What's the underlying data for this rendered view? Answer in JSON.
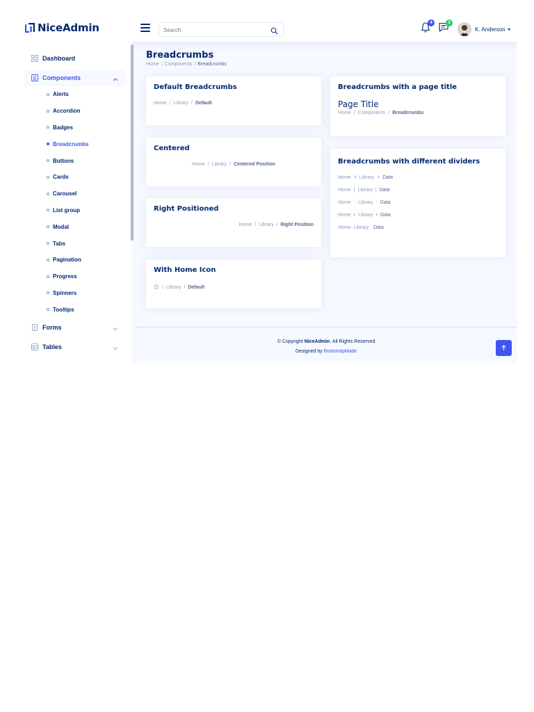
{
  "app": {
    "brand": "NiceAdmin"
  },
  "header": {
    "search_placeholder": "Search",
    "notifications_count": "4",
    "messages_count": "3",
    "profile_name": "K. Anderson"
  },
  "colors": {
    "accent": "#4154f1",
    "navy": "#012970",
    "muted": "#899bbd",
    "notif_badge": "#4154f1",
    "msg_badge": "#2eca6a"
  },
  "sidebar": {
    "items": [
      {
        "label": "Dashboard",
        "icon": "grid-icon"
      },
      {
        "label": "Components",
        "icon": "menu-icon",
        "expanded": true
      },
      {
        "label": "Forms",
        "icon": "journal-text-icon"
      },
      {
        "label": "Tables",
        "icon": "layout-text-icon"
      }
    ],
    "components": [
      "Alerts",
      "Accordion",
      "Badges",
      "Breadcrumbs",
      "Buttons",
      "Cards",
      "Carousel",
      "List group",
      "Modal",
      "Tabs",
      "Pagination",
      "Progress",
      "Spinners",
      "Tooltips"
    ],
    "active_sub": "Breadcrumbs"
  },
  "page": {
    "title": "Breadcrumbs",
    "crumb": {
      "home": "Home",
      "mid": "Components",
      "current": "Breadcrumbs"
    }
  },
  "cards": {
    "default": {
      "title": "Default Breadcrumbs",
      "home": "Home",
      "mid": "Library",
      "current": "Default"
    },
    "centered": {
      "title": "Centered",
      "home": "Home",
      "mid": "Library",
      "current": "Centered Position"
    },
    "right": {
      "title": "Right Positioned",
      "home": "Home",
      "mid": "Library",
      "current": "Right Position"
    },
    "homeicon": {
      "title": "With Home Icon",
      "mid": "Library",
      "current": "Default"
    },
    "pagetitle": {
      "title": "Breadcrumbs with a page title",
      "page_title": "Page Title",
      "home": "Home",
      "mid": "Components",
      "current": "Breadcrumbs"
    },
    "dividers": {
      "title": "Breadcrumbs with different dividers",
      "rows": [
        {
          "home": "Home",
          "sep": ">",
          "mid": "Library",
          "current": "Data"
        },
        {
          "home": "Home",
          "sep": "|",
          "mid": "Library",
          "current": "Data"
        },
        {
          "home": "Home",
          "sep": "-",
          "mid": "Library",
          "current": "Data"
        },
        {
          "home": "Home",
          "sep": "•",
          "mid": "Library",
          "current": "Data"
        },
        {
          "home": "Home",
          "sep": "",
          "mid": "Library",
          "current": "Data"
        }
      ]
    }
  },
  "footer": {
    "copyright_prefix": "© Copyright",
    "brand": "NiceAdmin",
    "rights": ". All Rights Reserved",
    "designed_prefix": "Designed by",
    "designer": "BootstrapMade"
  }
}
